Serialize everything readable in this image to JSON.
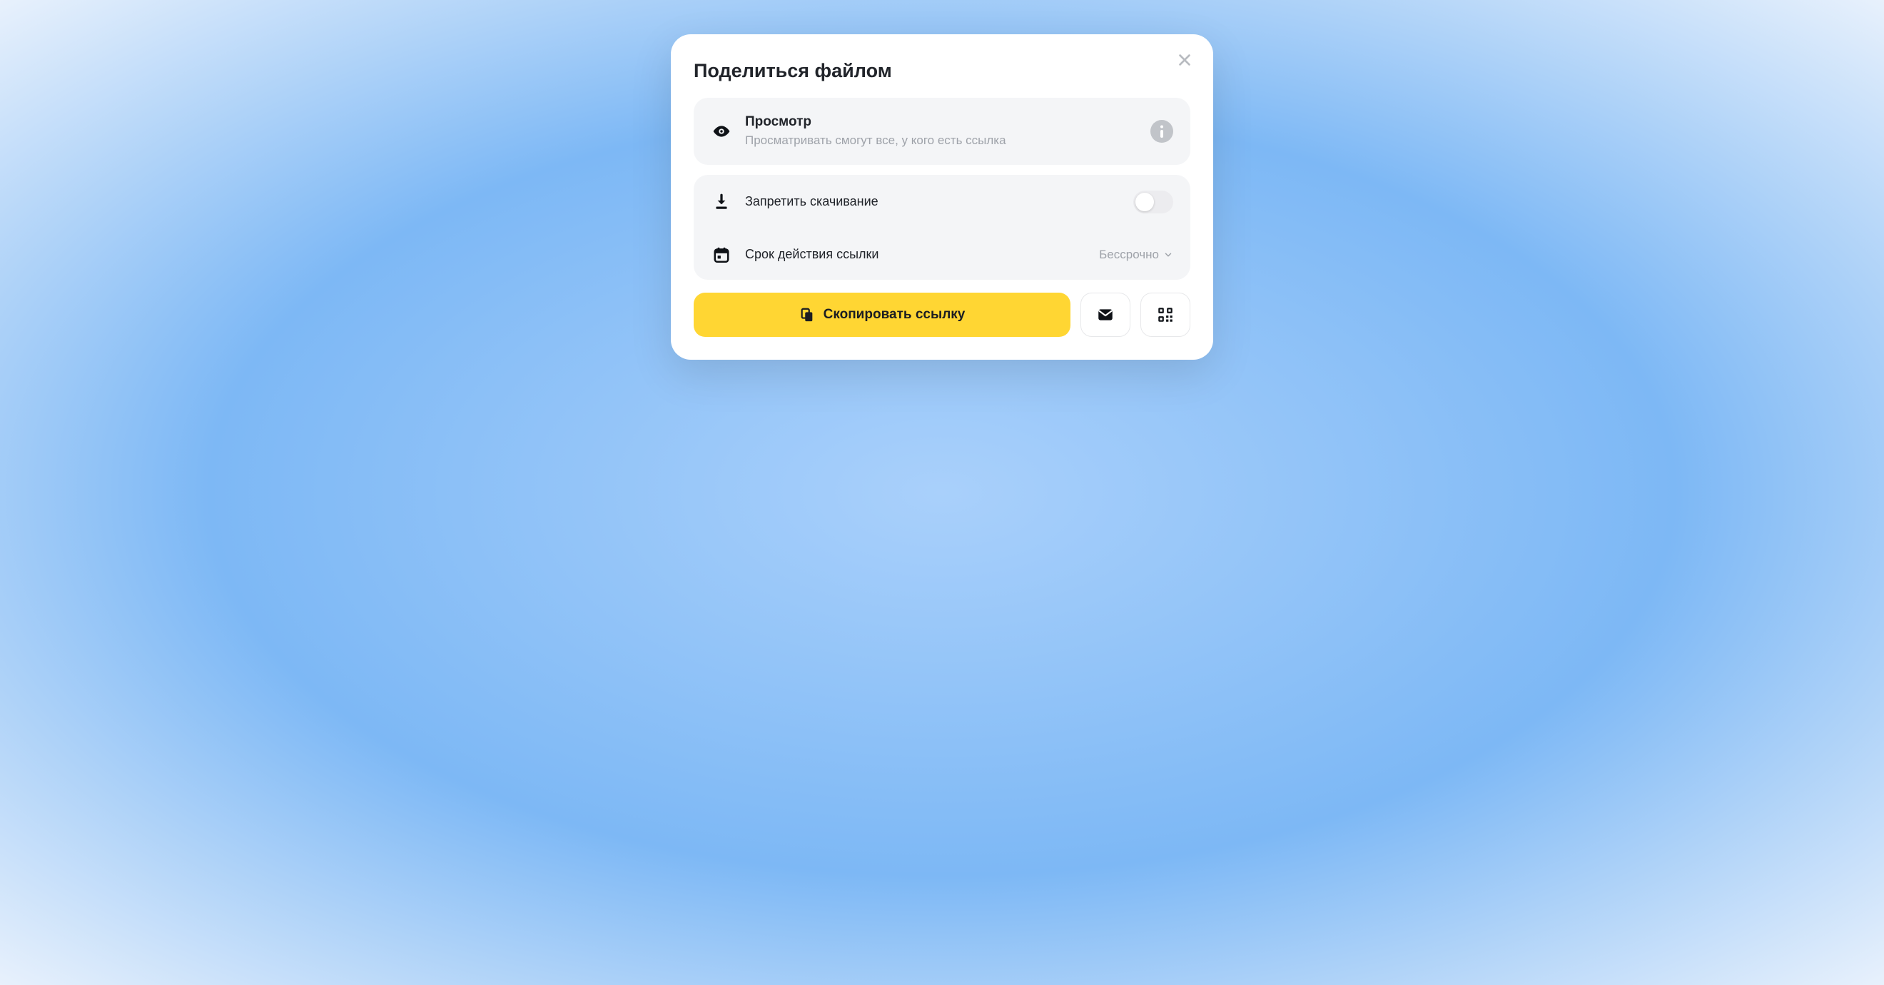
{
  "dialog": {
    "title": "Поделиться файлом",
    "access": {
      "title": "Просмотр",
      "subtitle": "Просматривать смогут все, у кого есть ссылка"
    },
    "options": {
      "disallow_download_label": "Запретить скачивание",
      "disallow_download_on": false,
      "expiry_label": "Срок действия ссылки",
      "expiry_value": "Бессрочно"
    },
    "actions": {
      "copy_link_label": "Скопировать ссылку"
    }
  }
}
